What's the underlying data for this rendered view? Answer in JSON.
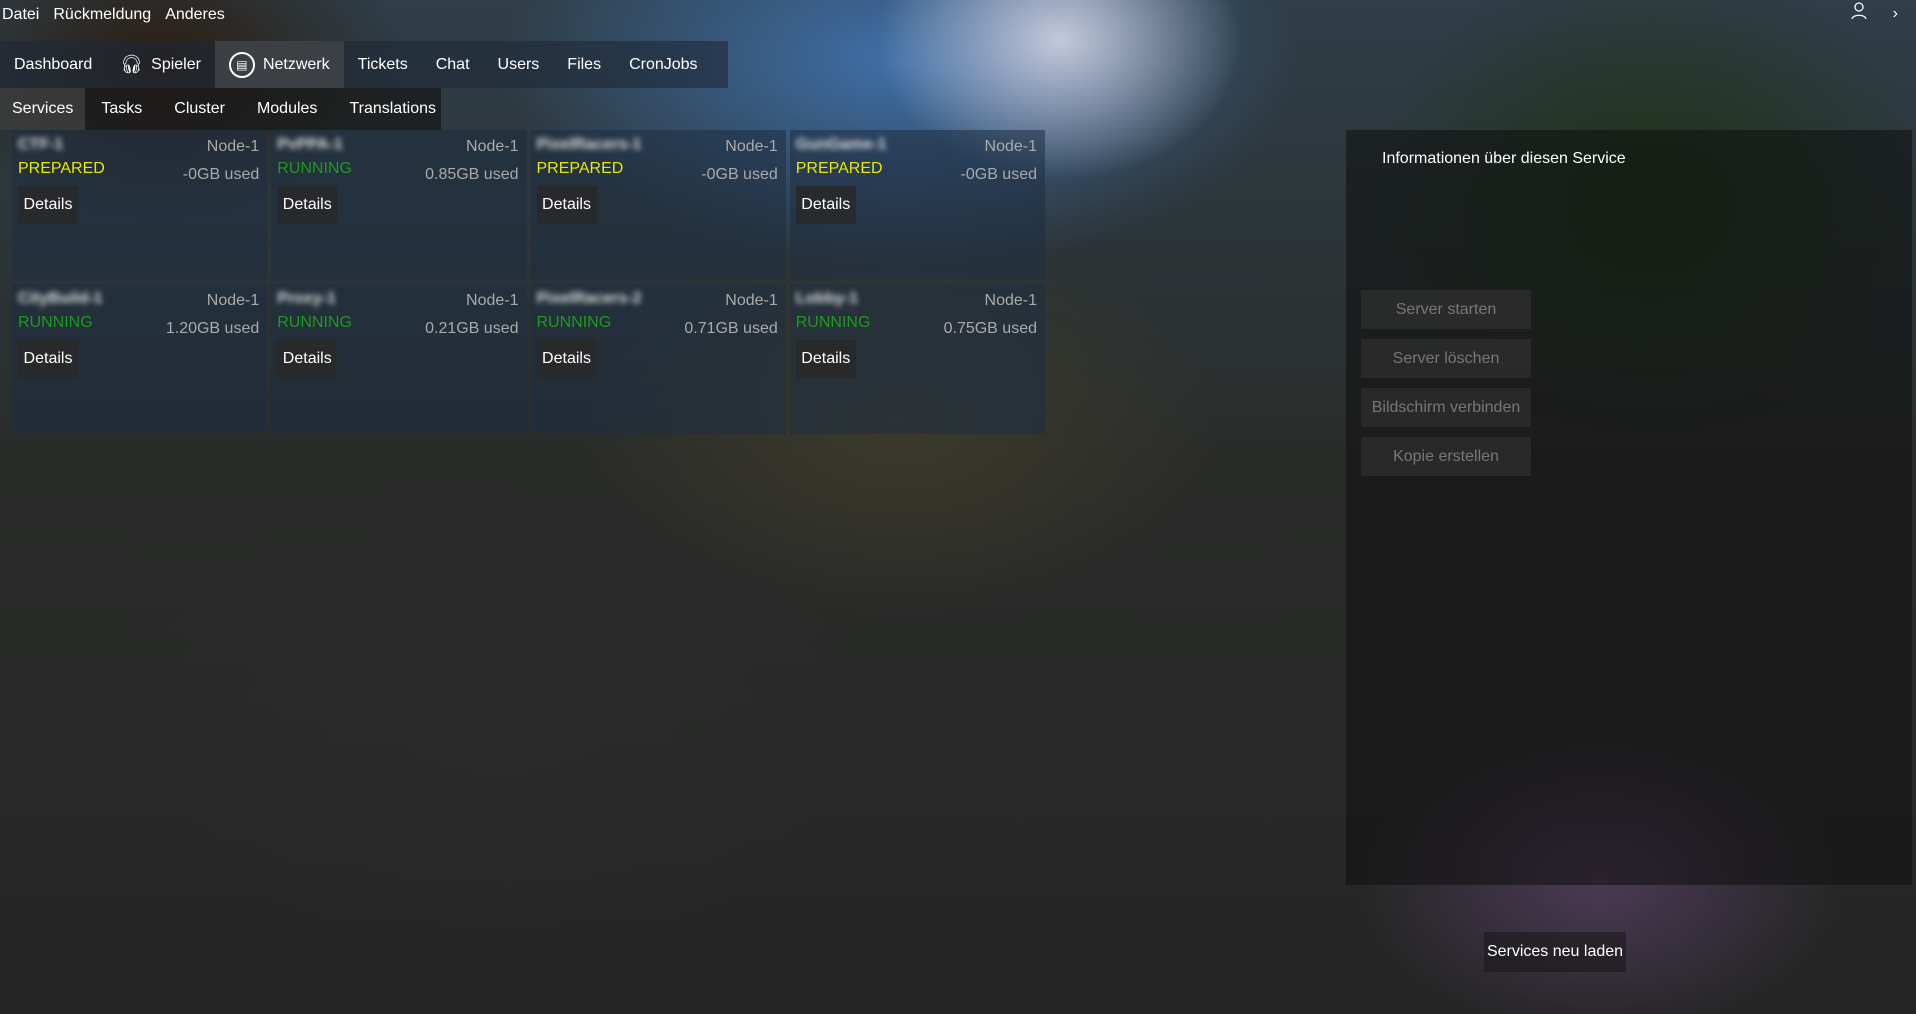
{
  "menu": [
    "Datei",
    "Rückmeldung",
    "Anderes"
  ],
  "nav": [
    {
      "label": "Dashboard"
    },
    {
      "label": "Spieler",
      "icon": "headset-icon"
    },
    {
      "label": "Netzwerk",
      "icon": "server-icon",
      "active": true
    },
    {
      "label": "Tickets"
    },
    {
      "label": "Chat"
    },
    {
      "label": "Users"
    },
    {
      "label": "Files"
    },
    {
      "label": "CronJobs"
    }
  ],
  "subnav": [
    {
      "label": "Services",
      "active": true
    },
    {
      "label": "Tasks"
    },
    {
      "label": "Cluster"
    },
    {
      "label": "Modules"
    },
    {
      "label": "Translations"
    }
  ],
  "status_colors": {
    "PREPARED": "#e8e800",
    "RUNNING": "#1f9a1f"
  },
  "services": [
    {
      "name": "CTF-1",
      "node": "Node-1",
      "status": "PREPARED",
      "used": "-0GB used",
      "details": "Details"
    },
    {
      "name": "PvPPA-1",
      "node": "Node-1",
      "status": "RUNNING",
      "used": "0.85GB used",
      "details": "Details"
    },
    {
      "name": "PixelRacers-1",
      "node": "Node-1",
      "status": "PREPARED",
      "used": "-0GB used",
      "details": "Details"
    },
    {
      "name": "GunGame-1",
      "node": "Node-1",
      "status": "PREPARED",
      "used": "-0GB used",
      "details": "Details"
    },
    {
      "name": "CityBuild-1",
      "node": "Node-1",
      "status": "RUNNING",
      "used": "1.20GB used",
      "details": "Details"
    },
    {
      "name": "Proxy-1",
      "node": "Node-1",
      "status": "RUNNING",
      "used": "0.21GB used",
      "details": "Details"
    },
    {
      "name": "PixelRacers-2",
      "node": "Node-1",
      "status": "RUNNING",
      "used": "0.71GB used",
      "details": "Details"
    },
    {
      "name": "Lobby-1",
      "node": "Node-1",
      "status": "RUNNING",
      "used": "0.75GB used",
      "details": "Details"
    }
  ],
  "panel": {
    "title": "Informationen über diesen Service",
    "buttons": [
      "Server starten",
      "Server löschen",
      "Bildschirm verbinden",
      "Kopie erstellen"
    ]
  },
  "reload_label": "Services neu laden",
  "topright": {
    "user_icon": "user-icon",
    "chevron": "›"
  }
}
